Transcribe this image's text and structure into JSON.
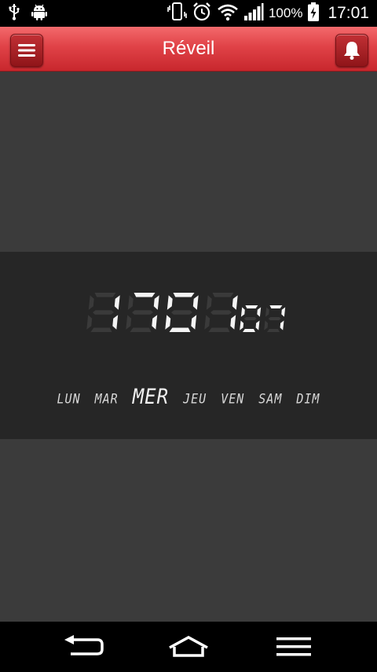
{
  "statusbar": {
    "battery_text": "100%",
    "time": "17:01",
    "icons": [
      "usb-icon",
      "android-icon",
      "vibrate-icon",
      "alarm-icon",
      "wifi-icon",
      "signal-icon",
      "battery-charging-icon"
    ]
  },
  "appbar": {
    "title": "Réveil",
    "menu_icon": "menu-icon",
    "bell_icon": "bell-icon",
    "color": "#e04247"
  },
  "clock": {
    "hours": "17",
    "minutes": "01",
    "seconds": "07",
    "digit_color": "#f4f4f4",
    "ghost_color": "#3a3a3a"
  },
  "days": [
    {
      "label": "LUN",
      "active": false
    },
    {
      "label": "MAR",
      "active": false
    },
    {
      "label": "MER",
      "active": true
    },
    {
      "label": "JEU",
      "active": false
    },
    {
      "label": "VEN",
      "active": false
    },
    {
      "label": "SAM",
      "active": false
    },
    {
      "label": "DIM",
      "active": false
    }
  ],
  "navbar": {
    "icons": [
      "back-icon",
      "home-icon",
      "menu-icon"
    ]
  }
}
